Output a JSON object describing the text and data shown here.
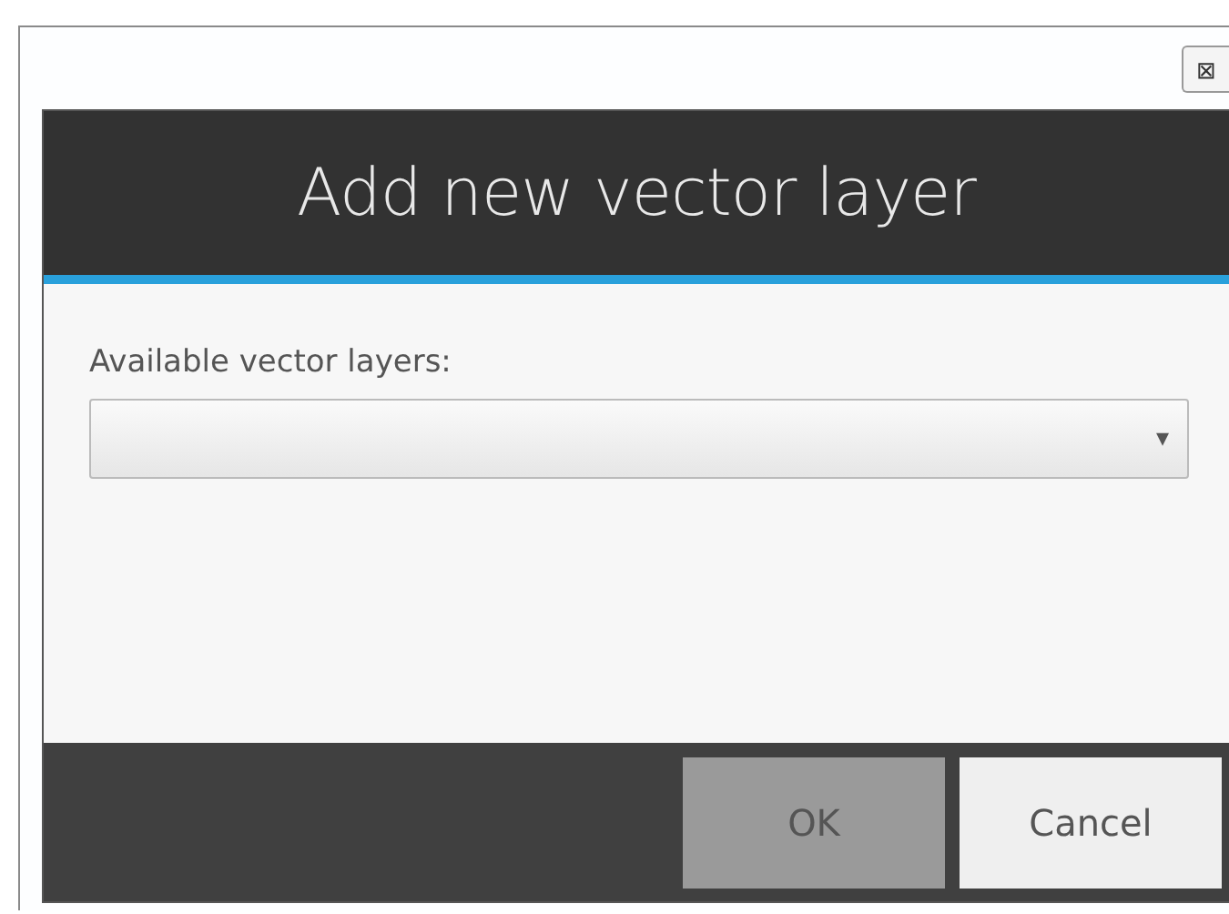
{
  "window": {
    "close_symbol": "⊠"
  },
  "dialog": {
    "title": "Add new vector layer",
    "field_label": "Available vector layers:",
    "dropdown": {
      "caret": "▾"
    },
    "buttons": [
      {
        "label": "OK",
        "kind": "primary",
        "disabled": true
      },
      {
        "label": "Cancel",
        "kind": "secondary",
        "disabled": false
      }
    ]
  }
}
